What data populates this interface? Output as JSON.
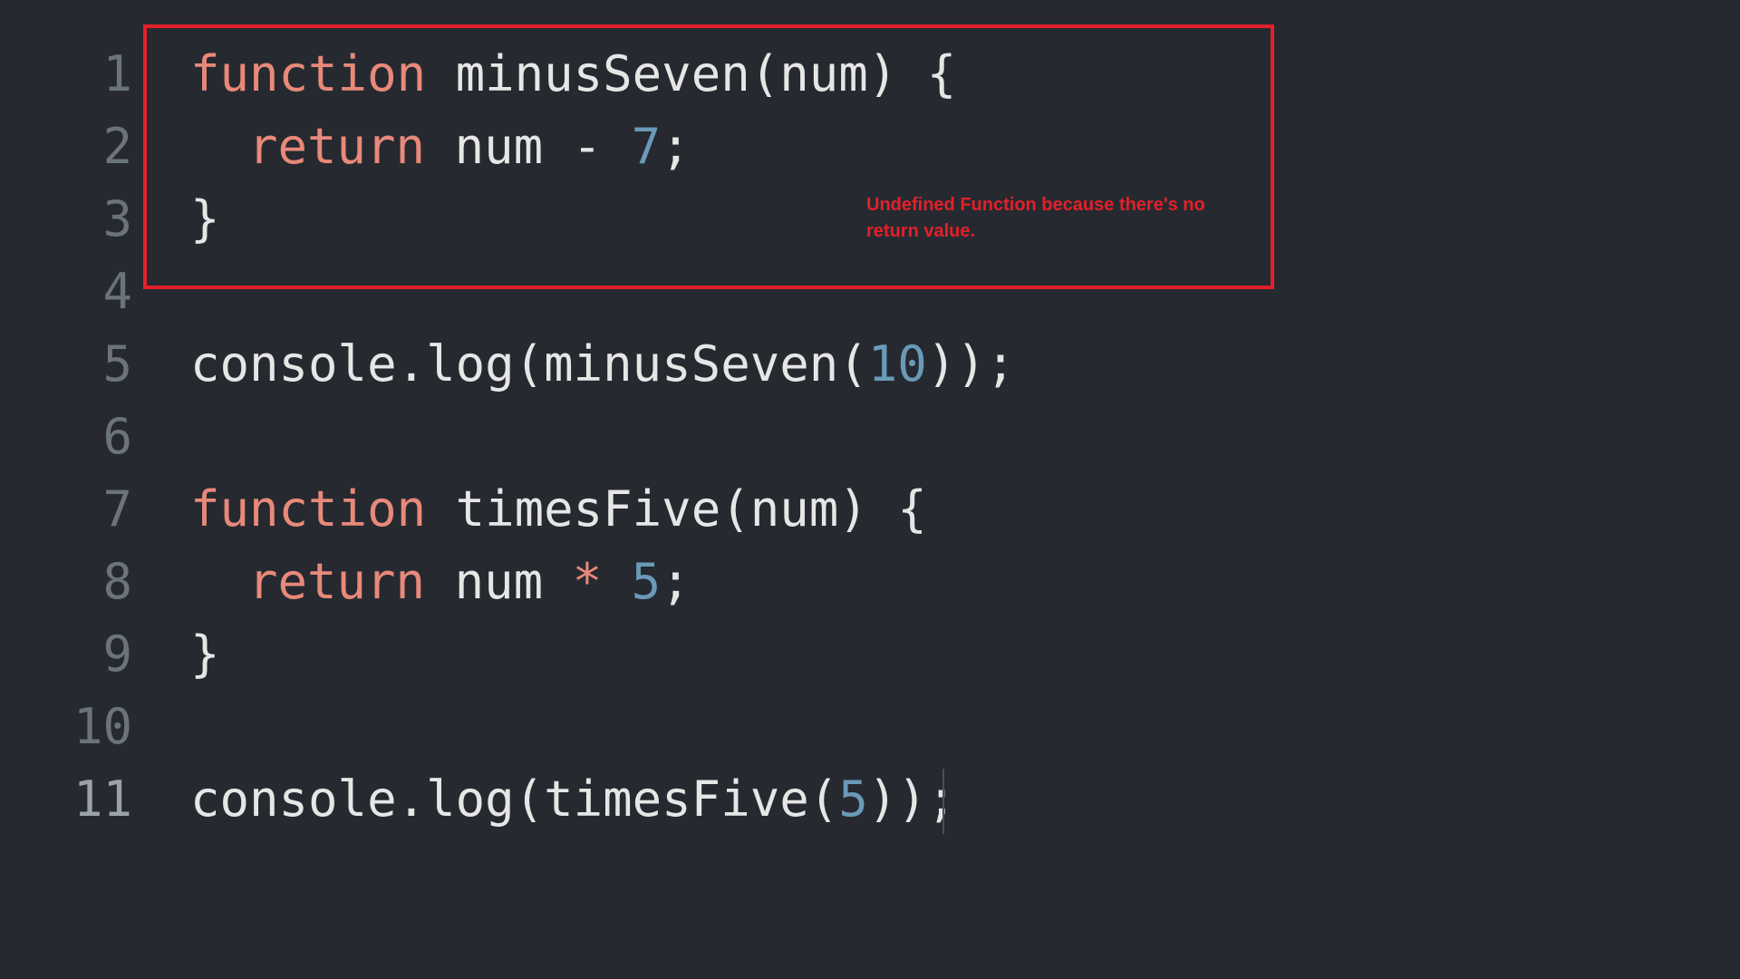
{
  "editor": {
    "lines": [
      {
        "number": "1",
        "tokens": [
          "function",
          " minusSeven(num) {"
        ]
      },
      {
        "number": "2",
        "tokens": [
          "return",
          " num ",
          "-",
          " ",
          "7",
          ";"
        ]
      },
      {
        "number": "3",
        "tokens": [
          "}"
        ]
      },
      {
        "number": "4",
        "tokens": []
      },
      {
        "number": "5",
        "tokens": [
          "console.log(minusSeven(",
          "10",
          "));"
        ]
      },
      {
        "number": "6",
        "tokens": []
      },
      {
        "number": "7",
        "tokens": [
          "function",
          " timesFive(num) {"
        ]
      },
      {
        "number": "8",
        "tokens": [
          "return",
          " num ",
          "*",
          " ",
          "5",
          ";"
        ]
      },
      {
        "number": "9",
        "tokens": [
          "}"
        ]
      },
      {
        "number": "10",
        "tokens": []
      },
      {
        "number": "11",
        "tokens": [
          "console.log(timesFive(",
          "5",
          "));"
        ]
      }
    ]
  },
  "annotation": {
    "text": "Undefined Function because there's no return value."
  },
  "colors": {
    "background": "#262a30",
    "keyword": "#e8897a",
    "number": "#6a9ab8",
    "text": "#e6e6e6",
    "gutter": "#6b737c",
    "annotation": "#e3202a"
  }
}
